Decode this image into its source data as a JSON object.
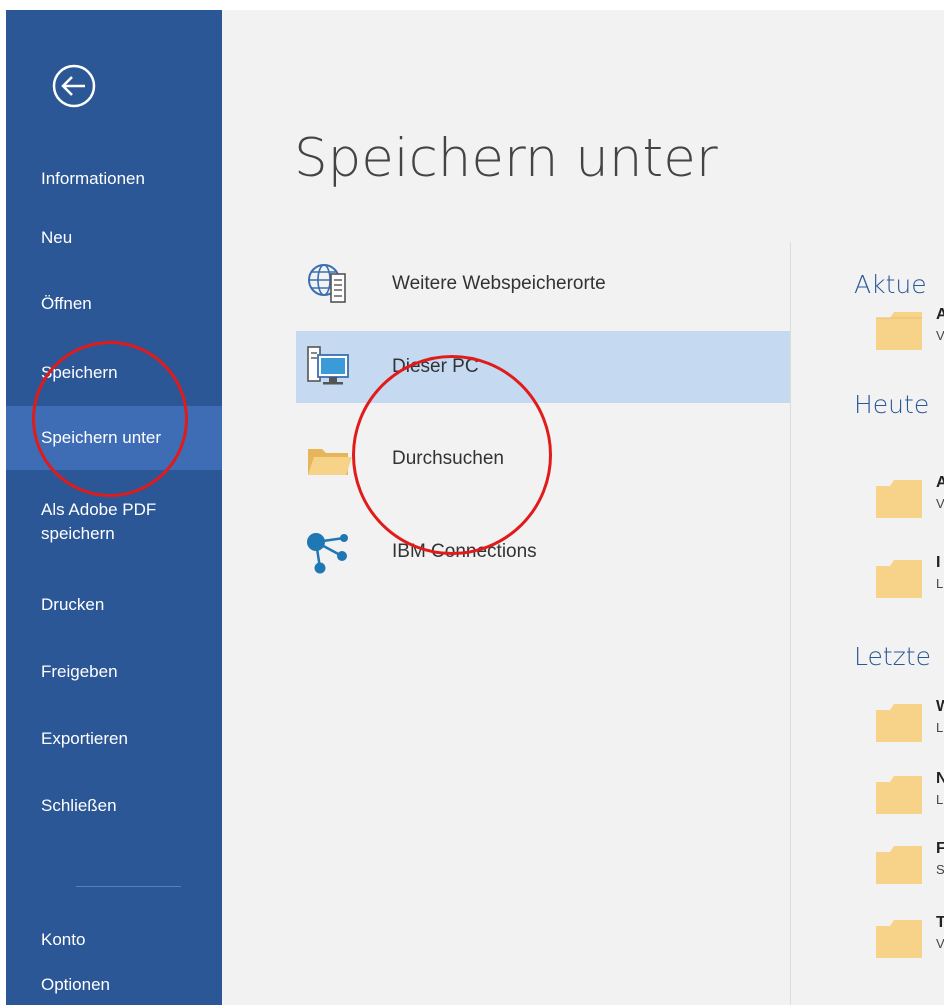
{
  "sidebar": {
    "items": [
      {
        "label": "Informationen"
      },
      {
        "label": "Neu"
      },
      {
        "label": "Öffnen"
      },
      {
        "label": "Speichern"
      },
      {
        "label": "Speichern unter",
        "active": true
      },
      {
        "label": "Als Adobe PDF\nspeichern"
      },
      {
        "label": "Drucken"
      },
      {
        "label": "Freigeben"
      },
      {
        "label": "Exportieren"
      },
      {
        "label": "Schließen"
      },
      {
        "label": "Konto"
      },
      {
        "label": "Optionen"
      }
    ]
  },
  "main": {
    "title": "Speichern unter",
    "locations": [
      {
        "label": "Weitere Webspeicherorte",
        "icon": "globe-server-icon"
      },
      {
        "label": "Dieser PC",
        "icon": "computer-icon",
        "selected": true
      },
      {
        "label": "Durchsuchen",
        "icon": "folder-icon"
      },
      {
        "label": "IBM Connections",
        "icon": "ibm-connections-icon"
      }
    ],
    "sections": [
      {
        "title": "Aktue",
        "folders": [
          {
            "name": "A",
            "path": "V"
          }
        ]
      },
      {
        "title": "Heute",
        "folders": [
          {
            "name": "A",
            "path": "V"
          },
          {
            "name": "I",
            "path": "L"
          }
        ]
      },
      {
        "title": "Letzte",
        "folders": [
          {
            "name": "W",
            "path": "L"
          },
          {
            "name": "N",
            "path": "L"
          },
          {
            "name": "F",
            "path": "S"
          },
          {
            "name": "T",
            "path": "V"
          }
        ]
      }
    ]
  },
  "colors": {
    "sidebar": "#2b5797",
    "sidebar_active": "#3e6db5",
    "selection": "#c5d9f1",
    "folder": "#f7d38a",
    "annotation": "#e11a1a"
  }
}
